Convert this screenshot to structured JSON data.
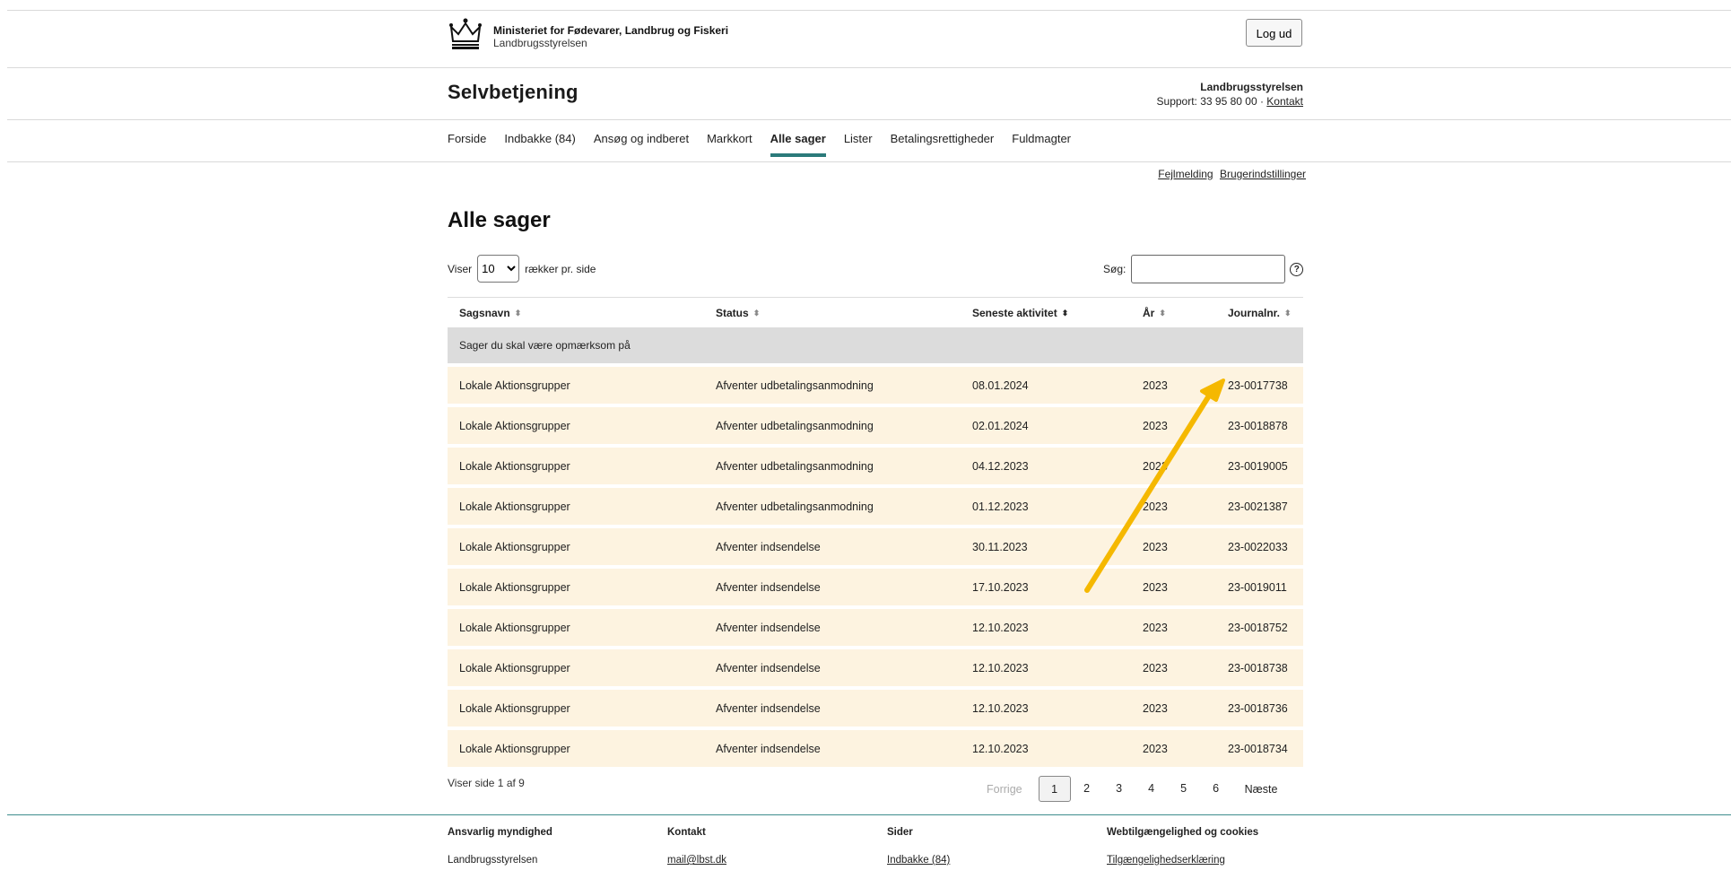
{
  "header": {
    "ministry_name": "Ministeriet for Fødevarer, Landbrug og Fiskeri",
    "agency_name": "Landbrugsstyrelsen",
    "logout_label": "Log ud"
  },
  "brand": {
    "title": "Selvbetjening",
    "support_org": "Landbrugsstyrelsen",
    "support_text": "Support: 33 95 80 00 ·",
    "contact_label": "Kontakt"
  },
  "nav": {
    "items": [
      "Forside",
      "Indbakke (84)",
      "Ansøg og indberet",
      "Markkort",
      "Alle sager",
      "Lister",
      "Betalingsrettigheder",
      "Fuldmagter"
    ],
    "active": "Alle sager"
  },
  "util_links": {
    "error_report": "Fejlmelding",
    "user_settings": "Brugerindstillinger"
  },
  "page": {
    "title": "Alle sager",
    "show_prefix": "Viser",
    "rows_per_page": "10",
    "show_suffix": "rækker pr. side",
    "search_label": "Søg:",
    "search_value": "",
    "help_icon": "?"
  },
  "table": {
    "headers": [
      "Sagsnavn",
      "Status",
      "Seneste aktivitet",
      "År",
      "Journalnr."
    ],
    "sorted_column": "Seneste aktivitet",
    "group_label": "Sager du skal være opmærksom på",
    "rows": [
      [
        "Lokale Aktionsgrupper",
        "Afventer udbetalingsanmodning",
        "08.01.2024",
        "2023",
        "23-0017738"
      ],
      [
        "Lokale Aktionsgrupper",
        "Afventer udbetalingsanmodning",
        "02.01.2024",
        "2023",
        "23-0018878"
      ],
      [
        "Lokale Aktionsgrupper",
        "Afventer udbetalingsanmodning",
        "04.12.2023",
        "2023",
        "23-0019005"
      ],
      [
        "Lokale Aktionsgrupper",
        "Afventer udbetalingsanmodning",
        "01.12.2023",
        "2023",
        "23-0021387"
      ],
      [
        "Lokale Aktionsgrupper",
        "Afventer indsendelse",
        "30.11.2023",
        "2023",
        "23-0022033"
      ],
      [
        "Lokale Aktionsgrupper",
        "Afventer indsendelse",
        "17.10.2023",
        "2023",
        "23-0019011"
      ],
      [
        "Lokale Aktionsgrupper",
        "Afventer indsendelse",
        "12.10.2023",
        "2023",
        "23-0018752"
      ],
      [
        "Lokale Aktionsgrupper",
        "Afventer indsendelse",
        "12.10.2023",
        "2023",
        "23-0018738"
      ],
      [
        "Lokale Aktionsgrupper",
        "Afventer indsendelse",
        "12.10.2023",
        "2023",
        "23-0018736"
      ],
      [
        "Lokale Aktionsgrupper",
        "Afventer indsendelse",
        "12.10.2023",
        "2023",
        "23-0018734"
      ]
    ]
  },
  "pagination": {
    "info": "Viser side 1 af 9",
    "prev": "Forrige",
    "pages": [
      "1",
      "2",
      "3",
      "4",
      "5",
      "6"
    ],
    "current": "1",
    "next": "Næste"
  },
  "footer": {
    "authority_heading": "Ansvarlig myndighed",
    "authority_name": "Landbrugsstyrelsen",
    "contact_heading": "Kontakt",
    "contact_email": "mail@lbst.dk",
    "pages_heading": "Sider",
    "pages_link": "Indbakke (84)",
    "access_heading": "Webtilgængelighed og cookies",
    "access_link": "Tilgængelighedserklæring"
  },
  "colors": {
    "accent": "#2b7a7a",
    "row_bg": "#fdf3e0",
    "group_bg": "#dcdcdc",
    "annotation_arrow": "#f5b800"
  }
}
